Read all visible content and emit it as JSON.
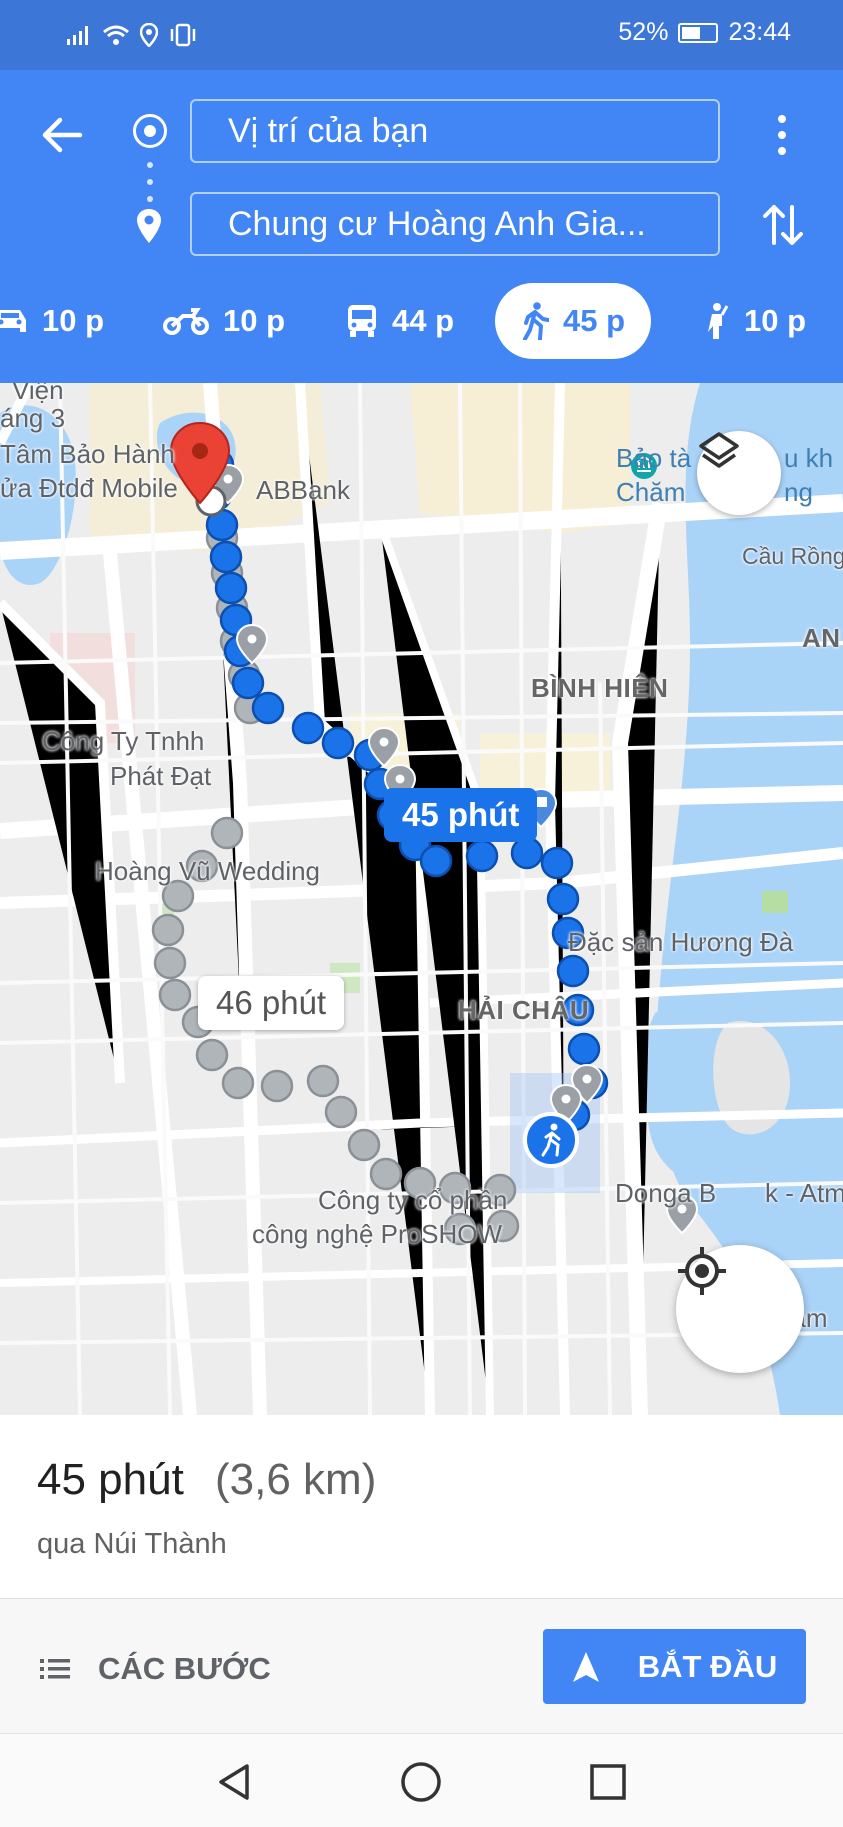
{
  "status_bar": {
    "battery": "52%",
    "time": "23:44"
  },
  "search": {
    "origin": "Vị trí của bạn",
    "destination": "Chung cư Hoàng Anh Gia..."
  },
  "modes": [
    {
      "name": "car",
      "time": "10 p",
      "active": false
    },
    {
      "name": "motorbike",
      "time": "10 p",
      "active": false
    },
    {
      "name": "transit",
      "time": "44 p",
      "active": false
    },
    {
      "name": "walking",
      "time": "45 p",
      "active": true
    },
    {
      "name": "ride",
      "time": "10 p",
      "active": false
    }
  ],
  "map": {
    "labels": {
      "vien": "Viện",
      "thang3": "áng 3",
      "tam_bao_hanh": "Tâm Bảo Hành",
      "sua_dtdd": "ửa Đtdđ Mobile",
      "abbank": "ABBank",
      "bao_tang_1": "Bảo tà",
      "bao_tang_1b": "u kh",
      "bao_tang_2": "Chăm",
      "bao_tang_2b": "ng",
      "cau_rong": "Cầu Rồng",
      "an": "AN",
      "binh_hien": "BÌNH HIÊN",
      "cong_ty_tnhh": "Công Ty Tnhh",
      "phat_dat": "Phát Đạt",
      "hoang_vu": "Hoàng Vũ Wedding",
      "dac_san": "Đặc sản Hương Đà",
      "hai_chau": "HẢI CHÂU",
      "donga_bank": "Donga B",
      "donga_bank_end": "k - Atm",
      "cong_ty_co_phan": "Công ty cổ phần",
      "cong_nghe": "công nghệ ProSHOW",
      "trung_tam": "Trung tâm"
    },
    "route_primary_label": "45 phút",
    "route_alt_label": "46 phút"
  },
  "summary": {
    "duration": "45 phút",
    "distance": "(3,6 km)",
    "via": "qua Núi Thành"
  },
  "actions": {
    "steps": "CÁC BƯỚC",
    "start": "BẮT ĐẦU"
  },
  "colors": {
    "header": "#4285f4",
    "route_primary": "#1a73e8",
    "route_alt": "#9aa0a6",
    "water": "#aad3f8"
  }
}
